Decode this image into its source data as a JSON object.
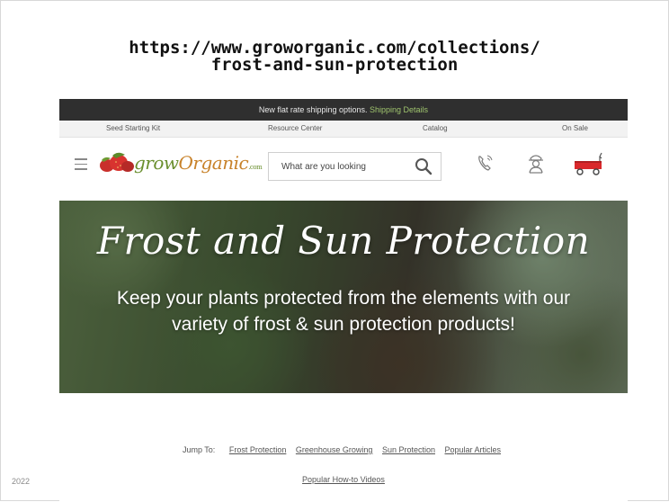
{
  "slide": {
    "url_line1": "https://www.groworganic.com/collections/",
    "url_line2": "frost-and-sun-protection",
    "footer_year": "2022"
  },
  "site": {
    "announcement": {
      "text": "New flat rate shipping options.",
      "link": "Shipping Details"
    },
    "top_nav": [
      "Seed Starting Kit",
      "Resource Center",
      "Catalog",
      "On Sale"
    ],
    "logo": {
      "part1": "grow",
      "part2": "Organic",
      "suffix": ".com"
    },
    "search": {
      "placeholder": "What are you looking"
    },
    "icons": [
      "menu-icon",
      "search-icon",
      "phone-icon",
      "account-icon",
      "cart-wagon-icon"
    ],
    "hero": {
      "title": "Frost and Sun Protection",
      "subtitle_line1": "Keep your plants protected from the elements with our",
      "subtitle_line2": "variety of frost & sun protection products!"
    },
    "jump_to": {
      "label": "Jump To:",
      "links": [
        "Frost Protection",
        "Greenhouse Growing",
        "Sun Protection",
        "Popular Articles",
        "Popular How-to Videos"
      ]
    }
  },
  "colors": {
    "announcement_bg": "#2f2f2f",
    "link_green": "#9fc46e",
    "logo_green": "#6a8f2e",
    "cart_red": "#d9282b"
  }
}
